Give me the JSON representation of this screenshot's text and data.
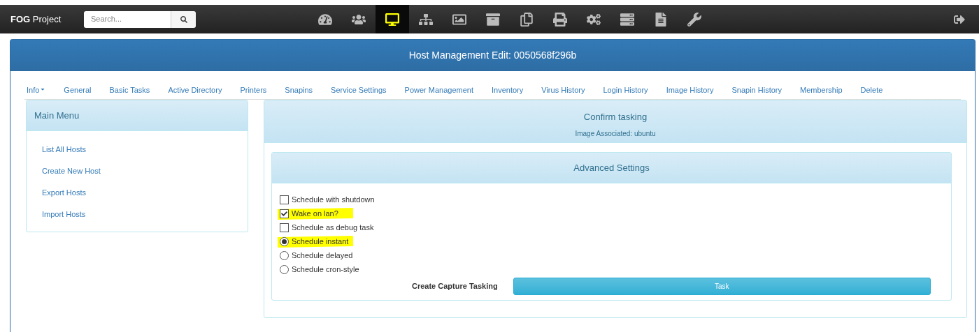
{
  "brand": {
    "bold": "FOG",
    "rest": "Project"
  },
  "search": {
    "placeholder": "Search..."
  },
  "nav_icons": [
    {
      "kind": "dashboard",
      "selected": false
    },
    {
      "kind": "users",
      "selected": false
    },
    {
      "kind": "monitor",
      "selected": true
    },
    {
      "kind": "sitemap",
      "selected": false
    },
    {
      "kind": "image",
      "selected": false
    },
    {
      "kind": "archive",
      "selected": false
    },
    {
      "kind": "copy",
      "selected": false
    },
    {
      "kind": "printer",
      "selected": false
    },
    {
      "kind": "gears",
      "selected": false
    },
    {
      "kind": "server",
      "selected": false
    },
    {
      "kind": "file",
      "selected": false
    },
    {
      "kind": "wrench",
      "selected": false
    }
  ],
  "page_title": "Host Management Edit: 0050568f296b",
  "tabs": [
    {
      "label": "Info",
      "dropdown": true
    },
    {
      "label": "General",
      "dropdown": false
    },
    {
      "label": "Basic Tasks",
      "dropdown": false
    },
    {
      "label": "Active Directory",
      "dropdown": false
    },
    {
      "label": "Printers",
      "dropdown": false
    },
    {
      "label": "Snapins",
      "dropdown": false
    },
    {
      "label": "Service Settings",
      "dropdown": false
    },
    {
      "label": "Power Management",
      "dropdown": false
    },
    {
      "label": "Inventory",
      "dropdown": false
    },
    {
      "label": "Virus History",
      "dropdown": false
    },
    {
      "label": "Login History",
      "dropdown": false
    },
    {
      "label": "Image History",
      "dropdown": false
    },
    {
      "label": "Snapin History",
      "dropdown": false
    },
    {
      "label": "Membership",
      "dropdown": false
    },
    {
      "label": "Delete",
      "dropdown": false
    }
  ],
  "main_menu": {
    "title": "Main Menu",
    "items": [
      "List All Hosts",
      "Create New Host",
      "Export Hosts",
      "Import Hosts"
    ]
  },
  "confirm": {
    "title": "Confirm tasking",
    "subtitle": "Image Associated: ubuntu"
  },
  "advanced": {
    "title": "Advanced Settings",
    "options": [
      {
        "kind": "checkbox",
        "label": "Schedule with shutdown",
        "checked": false,
        "highlighted": false
      },
      {
        "kind": "checkbox",
        "label": "Wake on lan?",
        "checked": true,
        "highlighted": true
      },
      {
        "kind": "checkbox",
        "label": "Schedule as debug task",
        "checked": false,
        "highlighted": false
      },
      {
        "kind": "radio",
        "label": "Schedule instant",
        "checked": true,
        "highlighted": true
      },
      {
        "kind": "radio",
        "label": "Schedule delayed",
        "checked": false,
        "highlighted": false
      },
      {
        "kind": "radio",
        "label": "Schedule cron-style",
        "checked": false,
        "highlighted": false
      }
    ],
    "action_label": "Create Capture Tasking",
    "button": "Task"
  }
}
